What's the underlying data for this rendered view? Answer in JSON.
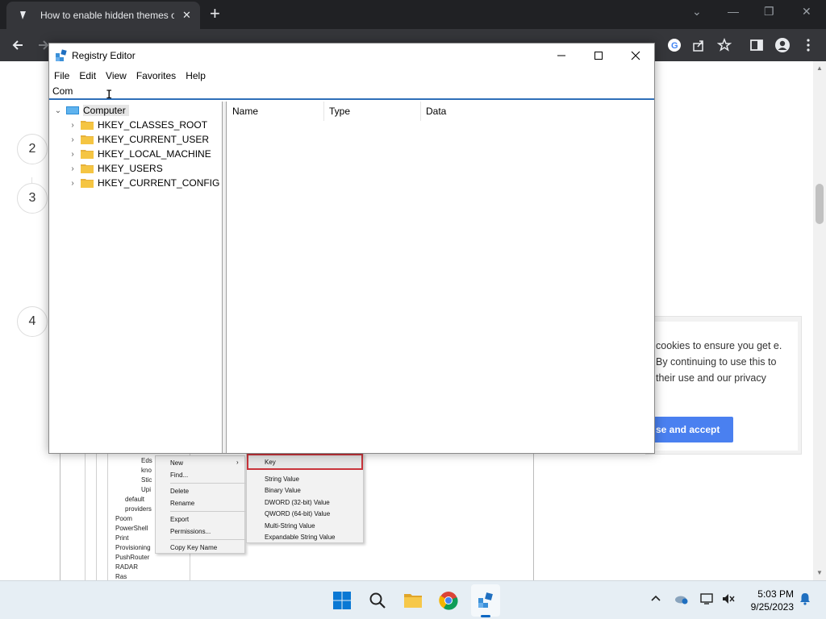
{
  "browser": {
    "tab_title": "How to enable hidden themes o",
    "tab_close": "✕",
    "new_tab": "+",
    "window_controls": [
      "⌄",
      "—",
      "❐",
      "✕"
    ]
  },
  "page": {
    "steps": [
      "2",
      "3",
      "4"
    ],
    "cookie": {
      "text": "cookies to ensure you get e. By continuing to use this to their use and our privacy",
      "button": "se and accept"
    },
    "embedded_tree": [
      "Eds",
      "kno",
      "Stic",
      "Upi",
      "default",
      "providers",
      "Poom",
      "PowerShell",
      "Print",
      "Provisioning",
      "PushRouter",
      "RADAR",
      "Ras"
    ],
    "context_menu": {
      "items": [
        "New",
        "Find...",
        "Delete",
        "Rename",
        "Export",
        "Permissions...",
        "Copy Key Name"
      ],
      "submenu": [
        "Key",
        "String Value",
        "Binary Value",
        "DWORD (32-bit) Value",
        "QWORD (64-bit) Value",
        "Multi-String Value",
        "Expandable String Value"
      ]
    }
  },
  "regedit": {
    "title": "Registry Editor",
    "menu": [
      "File",
      "Edit",
      "View",
      "Favorites",
      "Help"
    ],
    "address_value": "Com",
    "tree": {
      "root": "Computer",
      "hives": [
        "HKEY_CLASSES_ROOT",
        "HKEY_CURRENT_USER",
        "HKEY_LOCAL_MACHINE",
        "HKEY_USERS",
        "HKEY_CURRENT_CONFIG"
      ]
    },
    "columns": [
      "Name",
      "Type",
      "Data"
    ]
  },
  "taskbar": {
    "time": "5:03 PM",
    "date": "9/25/2023"
  },
  "colors": {
    "accent": "#2e6fb8",
    "cookie_button": "#4a80f0",
    "highlight_red": "#c8333a",
    "folder": "#f5c542"
  }
}
